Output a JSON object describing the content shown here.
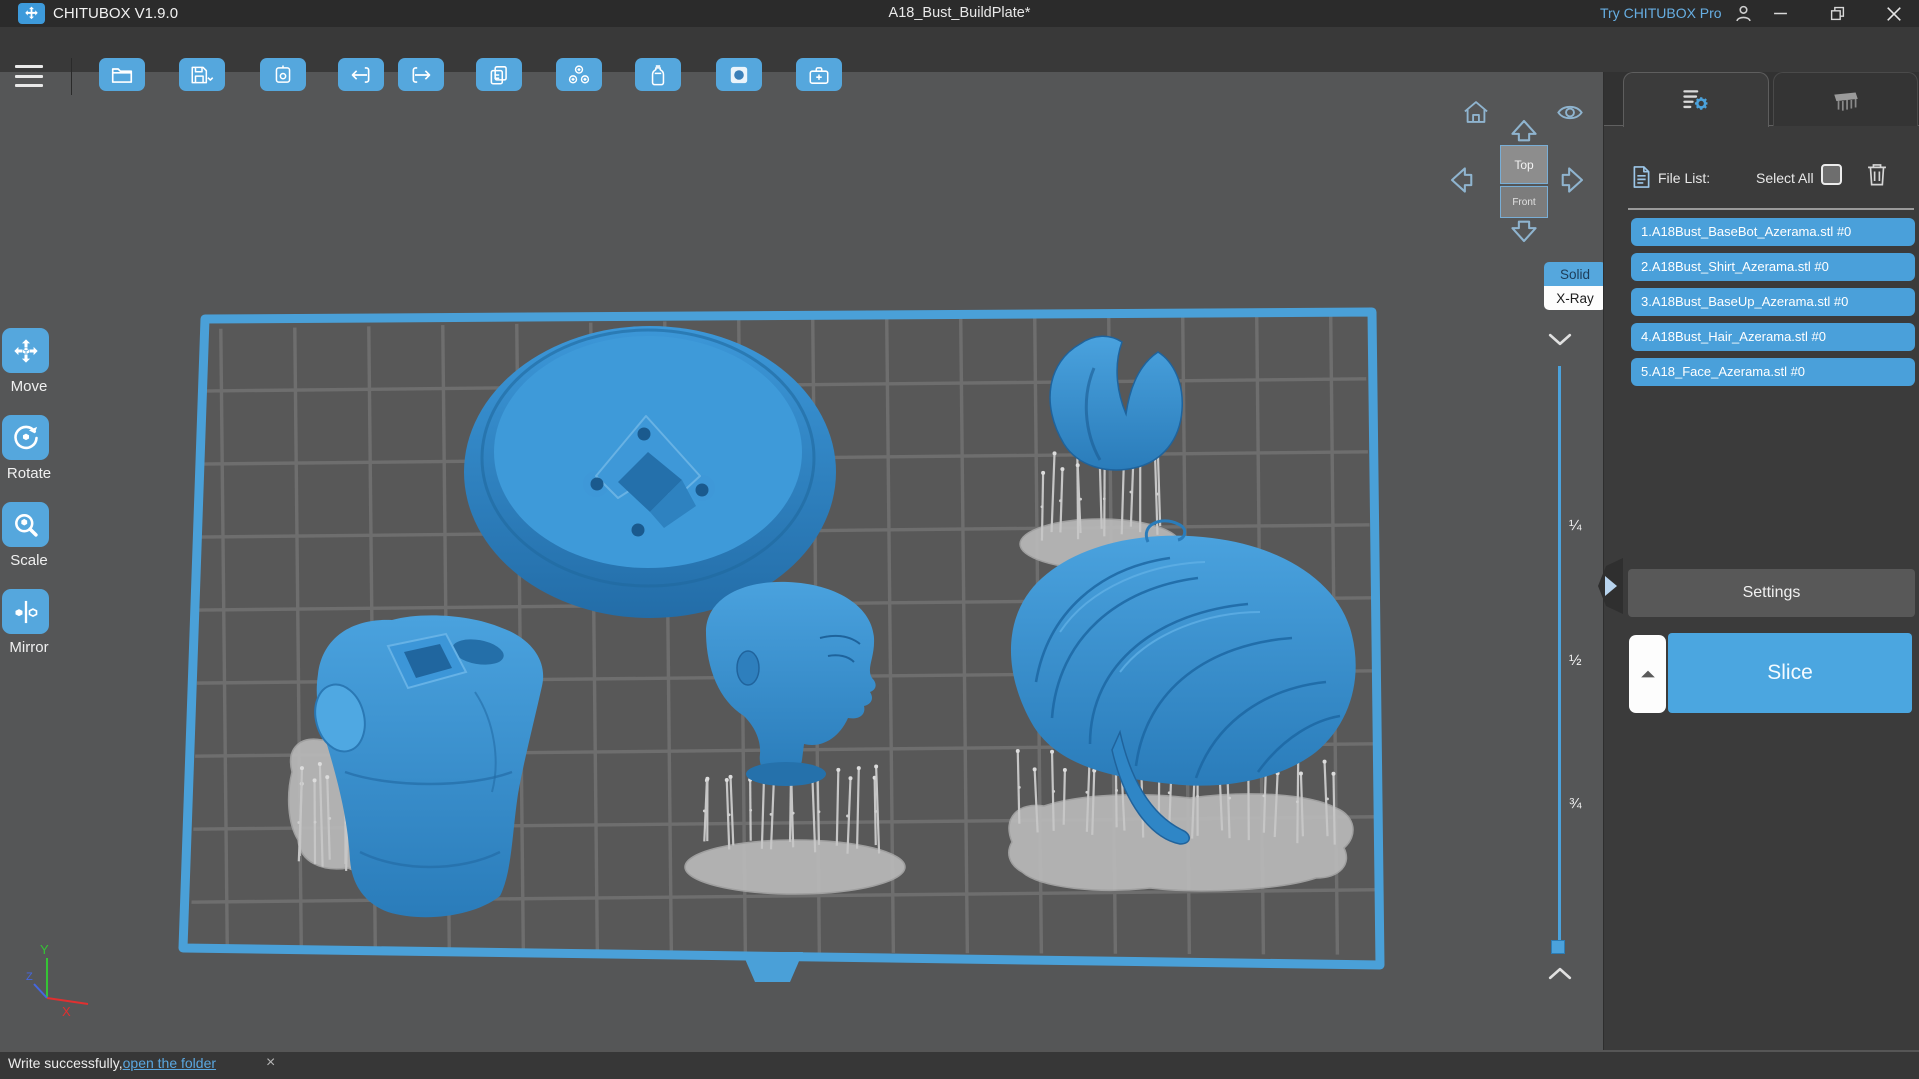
{
  "colors": {
    "accent": "#55a7dd",
    "file_item_blue": "#4aa0da",
    "panel_bg": "#3b3b3b",
    "viewport_bg": "#555657",
    "plate_border_blue": "#4aa0d8",
    "model_blue": "#2f8ccd",
    "support_gray": "#c6c6c6",
    "link_blue": "#5aa7e0"
  },
  "titlebar": {
    "app_name": "CHITUBOX V1.9.0",
    "document_title": "A18_Bust_BuildPlate*",
    "pro_link": "Try CHITUBOX Pro"
  },
  "toolbar": {
    "icons": [
      "open-folder",
      "save",
      "stamp",
      "undo",
      "redo",
      "clone",
      "auto-arrange",
      "hollow-bottle",
      "dig-hole",
      "repair-kit"
    ]
  },
  "left_tools": [
    {
      "label": "Move"
    },
    {
      "label": "Rotate"
    },
    {
      "label": "Scale"
    },
    {
      "label": "Mirror"
    }
  ],
  "viewport": {
    "nav_cube": {
      "top_face": "Top",
      "front_face": "Front"
    },
    "render_mode": {
      "solid": "Solid",
      "xray": "X-Ray"
    },
    "slider_marks": [
      "¼",
      "½",
      "¾"
    ],
    "axes": {
      "x": "X",
      "y": "Y",
      "z": "Z"
    }
  },
  "right_panel": {
    "file_list_label": "File List:",
    "select_all_label": "Select All",
    "files": [
      "1.A18Bust_BaseBot_Azerama.stl #0",
      "2.A18Bust_Shirt_Azerama.stl #0",
      "3.A18Bust_BaseUp_Azerama.stl #0",
      "4.A18Bust_Hair_Azerama.stl #0",
      "5.A18_Face_Azerama.stl #0"
    ],
    "settings_button": "Settings",
    "slice_button": "Slice"
  },
  "statusbar": {
    "message": "Write successfully,",
    "link_label": "open the folder",
    "close_glyph": "×"
  }
}
